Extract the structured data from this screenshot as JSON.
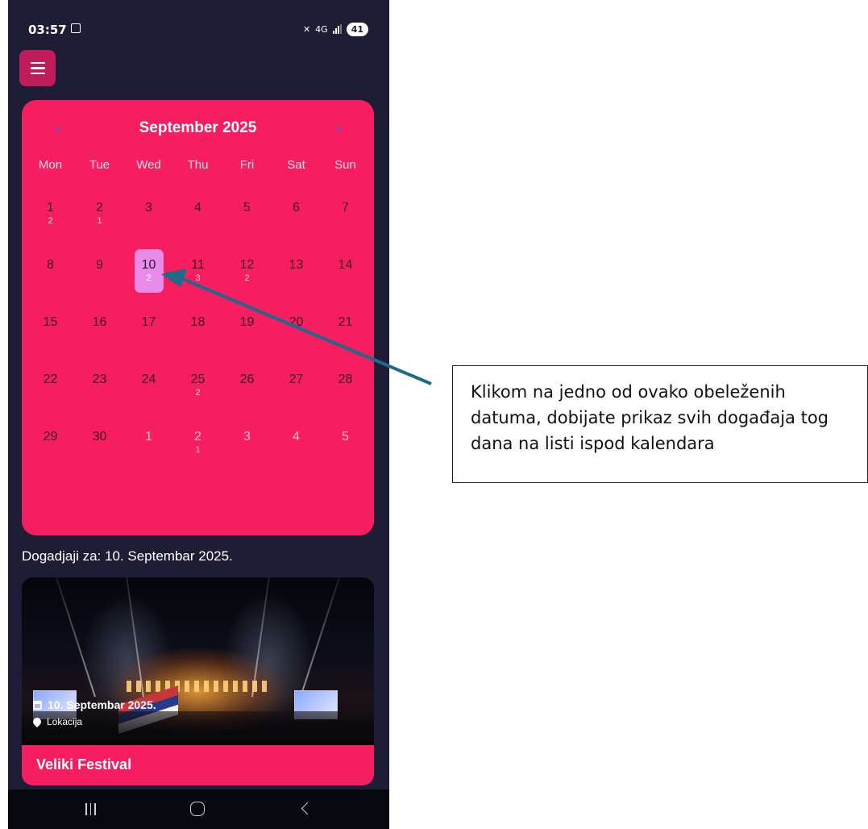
{
  "status_bar": {
    "time": "03:57",
    "network": "4G",
    "battery": "41"
  },
  "calendar": {
    "month_title": "September 2025",
    "weekdays": [
      "Mon",
      "Tue",
      "Wed",
      "Thu",
      "Fri",
      "Sat",
      "Sun"
    ],
    "days": [
      {
        "num": "1",
        "count": "2",
        "out": false,
        "selected": false
      },
      {
        "num": "2",
        "count": "1",
        "out": false,
        "selected": false
      },
      {
        "num": "3",
        "count": "",
        "out": false,
        "selected": false
      },
      {
        "num": "4",
        "count": "",
        "out": false,
        "selected": false
      },
      {
        "num": "5",
        "count": "",
        "out": false,
        "selected": false
      },
      {
        "num": "6",
        "count": "",
        "out": false,
        "selected": false
      },
      {
        "num": "7",
        "count": "",
        "out": false,
        "selected": false
      },
      {
        "num": "8",
        "count": "",
        "out": false,
        "selected": false
      },
      {
        "num": "9",
        "count": "",
        "out": false,
        "selected": false
      },
      {
        "num": "10",
        "count": "2",
        "out": false,
        "selected": true
      },
      {
        "num": "11",
        "count": "3",
        "out": false,
        "selected": false
      },
      {
        "num": "12",
        "count": "2",
        "out": false,
        "selected": false
      },
      {
        "num": "13",
        "count": "",
        "out": false,
        "selected": false
      },
      {
        "num": "14",
        "count": "",
        "out": false,
        "selected": false
      },
      {
        "num": "15",
        "count": "",
        "out": false,
        "selected": false
      },
      {
        "num": "16",
        "count": "",
        "out": false,
        "selected": false
      },
      {
        "num": "17",
        "count": "",
        "out": false,
        "selected": false
      },
      {
        "num": "18",
        "count": "",
        "out": false,
        "selected": false
      },
      {
        "num": "19",
        "count": "",
        "out": false,
        "selected": false
      },
      {
        "num": "20",
        "count": "",
        "out": false,
        "selected": false
      },
      {
        "num": "21",
        "count": "",
        "out": false,
        "selected": false
      },
      {
        "num": "22",
        "count": "",
        "out": false,
        "selected": false
      },
      {
        "num": "23",
        "count": "",
        "out": false,
        "selected": false
      },
      {
        "num": "24",
        "count": "",
        "out": false,
        "selected": false
      },
      {
        "num": "25",
        "count": "2",
        "out": false,
        "selected": false
      },
      {
        "num": "26",
        "count": "",
        "out": false,
        "selected": false
      },
      {
        "num": "27",
        "count": "",
        "out": false,
        "selected": false
      },
      {
        "num": "28",
        "count": "",
        "out": false,
        "selected": false
      },
      {
        "num": "29",
        "count": "",
        "out": false,
        "selected": false
      },
      {
        "num": "30",
        "count": "",
        "out": false,
        "selected": false
      },
      {
        "num": "1",
        "count": "",
        "out": true,
        "selected": false
      },
      {
        "num": "2",
        "count": "1",
        "out": true,
        "selected": false
      },
      {
        "num": "3",
        "count": "",
        "out": true,
        "selected": false
      },
      {
        "num": "4",
        "count": "",
        "out": true,
        "selected": false
      },
      {
        "num": "5",
        "count": "",
        "out": true,
        "selected": false
      }
    ]
  },
  "events": {
    "title": "Dogadjaji za: 10. Septembar 2025.",
    "items": [
      {
        "date": "10. Septembar 2025.",
        "location": "Lokacija",
        "name": "Veliki Festival"
      }
    ]
  },
  "annotation": {
    "text": "Klikom na jedno od ovako obeleženih datuma, dobijate prikaz svih događaja tog dana na listi ispod kalendara",
    "arrow_color": "#1f6a8a"
  },
  "colors": {
    "background": "#1f1c36",
    "accent": "#f71d61",
    "selected_day": "#e98be8",
    "menu_button": "#c01c5a"
  },
  "icons": [
    "menu-icon",
    "chevron-left-icon",
    "chevron-right-icon",
    "calendar-icon",
    "location-pin-icon",
    "recent-apps-icon",
    "home-icon",
    "back-icon"
  ]
}
